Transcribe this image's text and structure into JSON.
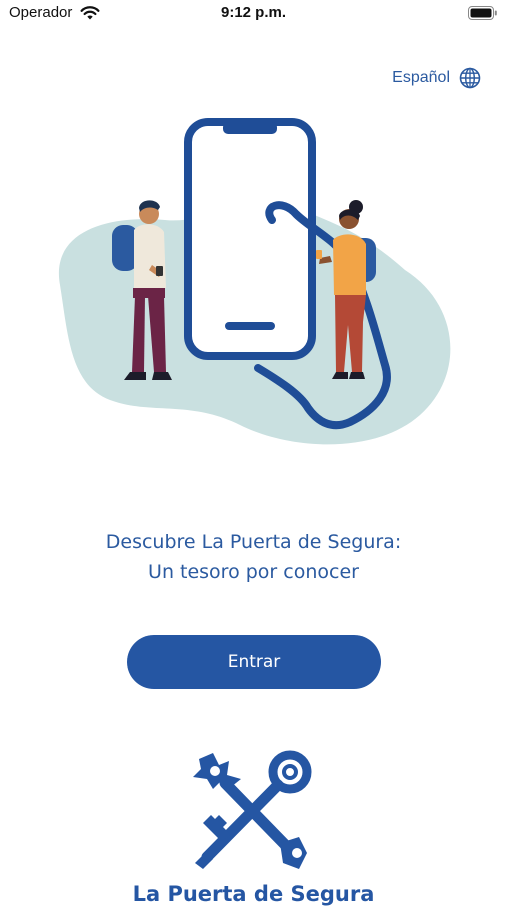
{
  "status_bar": {
    "carrier": "Operador",
    "time": "9:12 p.m."
  },
  "language": {
    "label": "Español",
    "icon": "globe-icon"
  },
  "illustration": {
    "icon": "phone-travelers-illustration"
  },
  "headline": {
    "line1": "Descubre La Puerta de Segura:",
    "line2": "Un tesoro por conocer"
  },
  "enter_button": {
    "label": "Entrar"
  },
  "logo": {
    "text": "La Puerta de Segura",
    "icon": "crossed-keys-logo"
  },
  "colors": {
    "primary": "#2556a3",
    "text_accent": "#2b5aa0",
    "blob": "#c9e0e0",
    "phone_outline": "#1f4d97"
  }
}
